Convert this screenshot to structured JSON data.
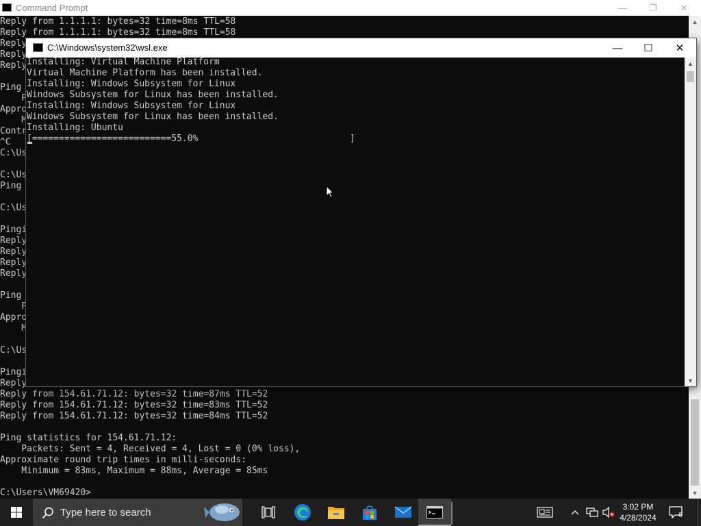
{
  "cmd_window": {
    "title": "Command Prompt",
    "visible_lines_top": [
      "Reply from 1.1.1.1: bytes=32 time=8ms TTL=58",
      "Reply from 1.1.1.1: bytes=32 time=8ms TTL=58"
    ],
    "left_fragments": [
      "Reply",
      "Reply",
      "Reply",
      "",
      "Ping ",
      "    P",
      "Appro",
      "    M",
      "Contr",
      "^C",
      "C:\\Us",
      "",
      "C:\\Us",
      "Ping ",
      "",
      "C:\\Us",
      "",
      "Pingi",
      "Reply",
      "Reply",
      "Reply",
      "Reply",
      "",
      "Ping ",
      "    P",
      "Appro",
      "    M",
      "",
      "C:\\Us",
      "",
      "Pingi",
      "Reply"
    ],
    "bottom_lines": [
      "Reply from 154.61.71.12: bytes=32 time=87ms TTL=52",
      "Reply from 154.61.71.12: bytes=32 time=83ms TTL=52",
      "Reply from 154.61.71.12: bytes=32 time=84ms TTL=52",
      "",
      "Ping statistics for 154.61.71.12:",
      "    Packets: Sent = 4, Received = 4, Lost = 0 (0% loss),",
      "Approximate round trip times in milli-seconds:",
      "    Minimum = 83ms, Maximum = 88ms, Average = 85ms",
      "",
      "C:\\Users\\VM69420>"
    ]
  },
  "wsl_window": {
    "title": "C:\\Windows\\system32\\wsl.exe",
    "lines": [
      "Installing: Virtual Machine Platform",
      "Virtual Machine Platform has been installed.",
      "Installing: Windows Subsystem for Linux",
      "Windows Subsystem for Linux has been installed.",
      "Installing: Windows Subsystem for Linux",
      "Windows Subsystem for Linux has been installed.",
      "Installing: Ubuntu"
    ],
    "progress": {
      "text": "[==========================55.0%",
      "end": "]",
      "percent": 55.0
    },
    "buttons": {
      "minimize": "—",
      "maximize": "☐",
      "close": "✕"
    }
  },
  "taskbar": {
    "search_placeholder": "Type here to search",
    "clock_time": "3:02 PM",
    "clock_date": "4/28/2024",
    "notification_count": "6",
    "apps": [
      "task-view",
      "edge",
      "file-explorer",
      "microsoft-store",
      "mail",
      "command-prompt"
    ]
  },
  "colors": {
    "console_bg": "#0c0c0c",
    "console_text": "#cccccc",
    "taskbar_bg": "#1f1f1f",
    "search_bg": "#3b3b3b"
  }
}
